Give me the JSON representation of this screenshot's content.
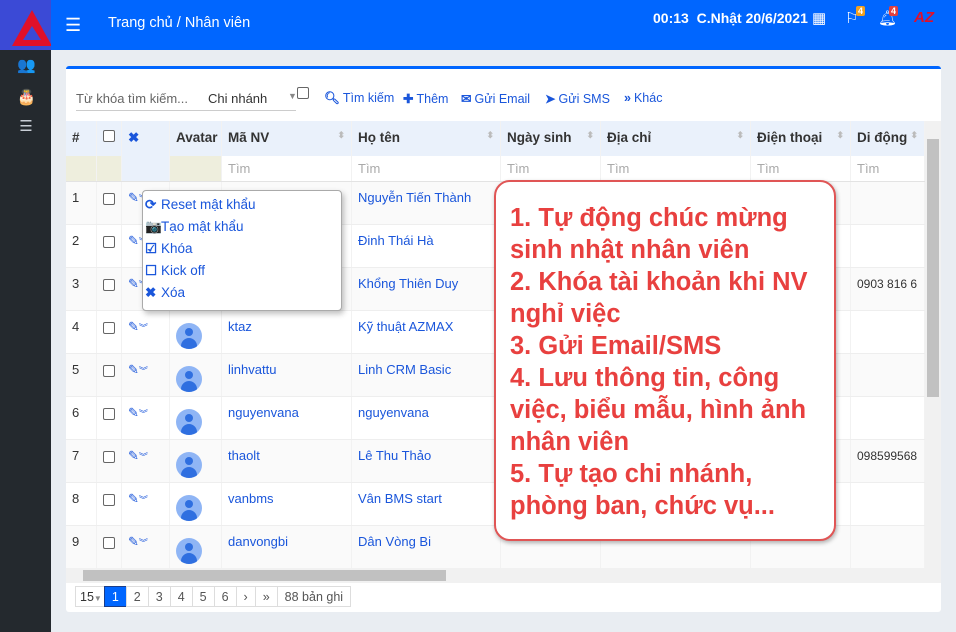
{
  "sidebar": {
    "items": [
      {
        "icon": "users-icon",
        "glyph": "👥"
      },
      {
        "icon": "birthday-cake-icon",
        "glyph": "🎂"
      },
      {
        "icon": "list-icon",
        "glyph": "☰"
      }
    ]
  },
  "header": {
    "breadcrumb_home": "Trang chủ",
    "breadcrumb_sep": "/",
    "breadcrumb_current": "Nhân viên",
    "time": "00:13",
    "date": "C.Nhật 20/6/2021",
    "flag_badge": "4",
    "bell_badge": "4",
    "brand": "AZ"
  },
  "colors": {
    "primary": "#0066ff",
    "callout": "#e8403f",
    "sidebar": "#24292e",
    "badge_flag": "#f0a020",
    "badge_bell": "#e04040"
  },
  "toolbar": {
    "keyword_placeholder": "Từ khóa tìm kiếm...",
    "branch": "Chi nhánh",
    "search": "Tìm kiếm",
    "add": "Thêm",
    "email": "Gửi Email",
    "sms": "Gửi SMS",
    "more": "Khác"
  },
  "table": {
    "headers": [
      "#",
      "",
      "",
      "Avatar",
      "Mã NV",
      "Họ tên",
      "Ngày sinh",
      "Địa chỉ",
      "Điện thoại",
      "Di động"
    ],
    "filter_placeholder": "Tìm",
    "rows": [
      {
        "n": "1",
        "code": "",
        "name": "Nguyễn Tiến Thành",
        "mobile": ""
      },
      {
        "n": "2",
        "code": "",
        "name": "Đinh Thái Hà",
        "mobile": ""
      },
      {
        "n": "3",
        "code": "",
        "name": "Khổng Thiên Duy",
        "mobile": "0903 816 6"
      },
      {
        "n": "4",
        "code": "ktaz",
        "name": "Kỹ thuật AZMAX",
        "mobile": ""
      },
      {
        "n": "5",
        "code": "linhvattu",
        "name": "Linh CRM Basic",
        "mobile": ""
      },
      {
        "n": "6",
        "code": "nguyenvana",
        "name": "nguyenvana",
        "mobile": ""
      },
      {
        "n": "7",
        "code": "thaolt",
        "name": "Lê Thu Thảo",
        "mobile": "098599568"
      },
      {
        "n": "8",
        "code": "vanbms",
        "name": "Vân BMS start",
        "mobile": ""
      },
      {
        "n": "9",
        "code": "danvongbi",
        "name": "Dân Vòng Bi",
        "mobile": ""
      }
    ]
  },
  "context_menu": [
    {
      "icon": "refresh-icon",
      "glyph": "⟳",
      "label": "Reset mật khẩu"
    },
    {
      "icon": "camera-icon",
      "glyph": "📷",
      "label": "Tạo mật khẩu"
    },
    {
      "icon": "check-square-icon",
      "glyph": "☑",
      "label": "Khóa"
    },
    {
      "icon": "square-icon",
      "glyph": "☐",
      "label": "Kick off"
    },
    {
      "icon": "close-icon",
      "glyph": "✖",
      "label": "Xóa"
    }
  ],
  "pagination": {
    "page_size": "15",
    "pages": [
      "1",
      "2",
      "3",
      "4",
      "5",
      "6"
    ],
    "current": "1",
    "next": "›",
    "last": "»",
    "total": "88 bản ghi"
  },
  "callout": {
    "lines": [
      "1. Tự động chúc mừng sinh nhật nhân viên",
      "2. Khóa tài khoản khi NV nghỉ việc",
      "3. Gửi Email/SMS",
      "4. Lưu thông tin, công việc, biểu mẫu, hình ảnh nhân viên",
      "5. Tự tạo chi nhánh, phòng ban, chức vụ..."
    ]
  }
}
